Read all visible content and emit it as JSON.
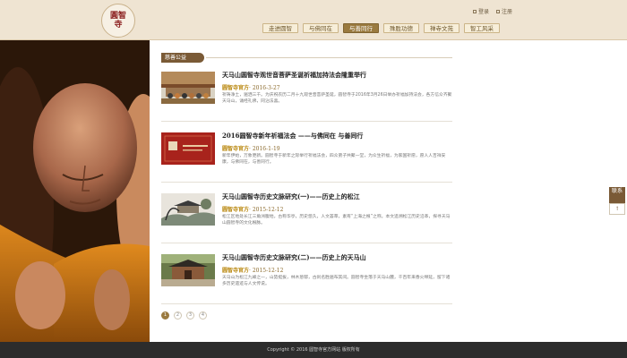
{
  "header": {
    "logo_text": "圓智寺",
    "login": "登录",
    "register": "注册"
  },
  "nav": {
    "items": [
      {
        "label": "走进圆智"
      },
      {
        "label": "与佛同在"
      },
      {
        "label": "与善同行"
      },
      {
        "label": "殊胜功德"
      },
      {
        "label": "禅寺文苑"
      },
      {
        "label": "智工风采"
      }
    ],
    "active_index": 2
  },
  "section": {
    "title": "慈善公益"
  },
  "articles": [
    {
      "title": "天马山圆智寺观世音菩萨圣诞祈福加持法会隆重举行",
      "source": "圆智寺官方",
      "date": "· 2016-3-27",
      "summary": "祈祷净土，遍洒三千。为庆祝农历二月十九观世音菩萨圣诞，圆智寺于2016年3月26日举办祈福加持法会，各方信众齐聚天马山，诵经礼佛，同沾法喜。"
    },
    {
      "title": "2016圆智寺新年祈福法会 ——与佛同在 与善同行",
      "source": "圆智寺官方",
      "date": "· 2016-1-19",
      "summary": "新年伊始，万象更新。圆智寺于新年之际举行祈福法会，四众弟子共聚一堂，为众生祈福，为家国祈愿，愿人人吉祥安康，与佛同在，与善同行。"
    },
    {
      "title": "天马山圆智寺历史文脉研究(一)——历史上的松江",
      "source": "圆智寺官方",
      "date": "· 2015-12-12",
      "summary": "松江区地处长江三角洲腹地，古称华亭，历史悠久，人文荟萃，素有“上海之根”之称。本文追溯松江历史沿革，探寻天马山圆智寺的文化根脉。"
    },
    {
      "title": "天马山圆智寺历史文脉研究(二)——历史上的天马山",
      "source": "圆智寺官方",
      "date": "· 2015-12-12",
      "summary": "天马山为松江九峰之一，山势挺拔，林木葱郁，古刹名胜遍布其间。圆智寺坐落于天马山麓，千百年来香火绵延，留下诸多历史遗迹与人文传说。"
    }
  ],
  "pagination": {
    "pages": [
      "1",
      "2",
      "3",
      "4"
    ],
    "active_index": 0
  },
  "side_tools": {
    "contact_label": "联系",
    "top_label": "↑"
  },
  "footer": {
    "copyright": "Copyright © 2016 圆智寺官方网站 版权所有"
  },
  "colors": {
    "accent": "#9a7a3f",
    "header_bg": "#efe4d2",
    "footer_bg": "#2c2c2c"
  }
}
